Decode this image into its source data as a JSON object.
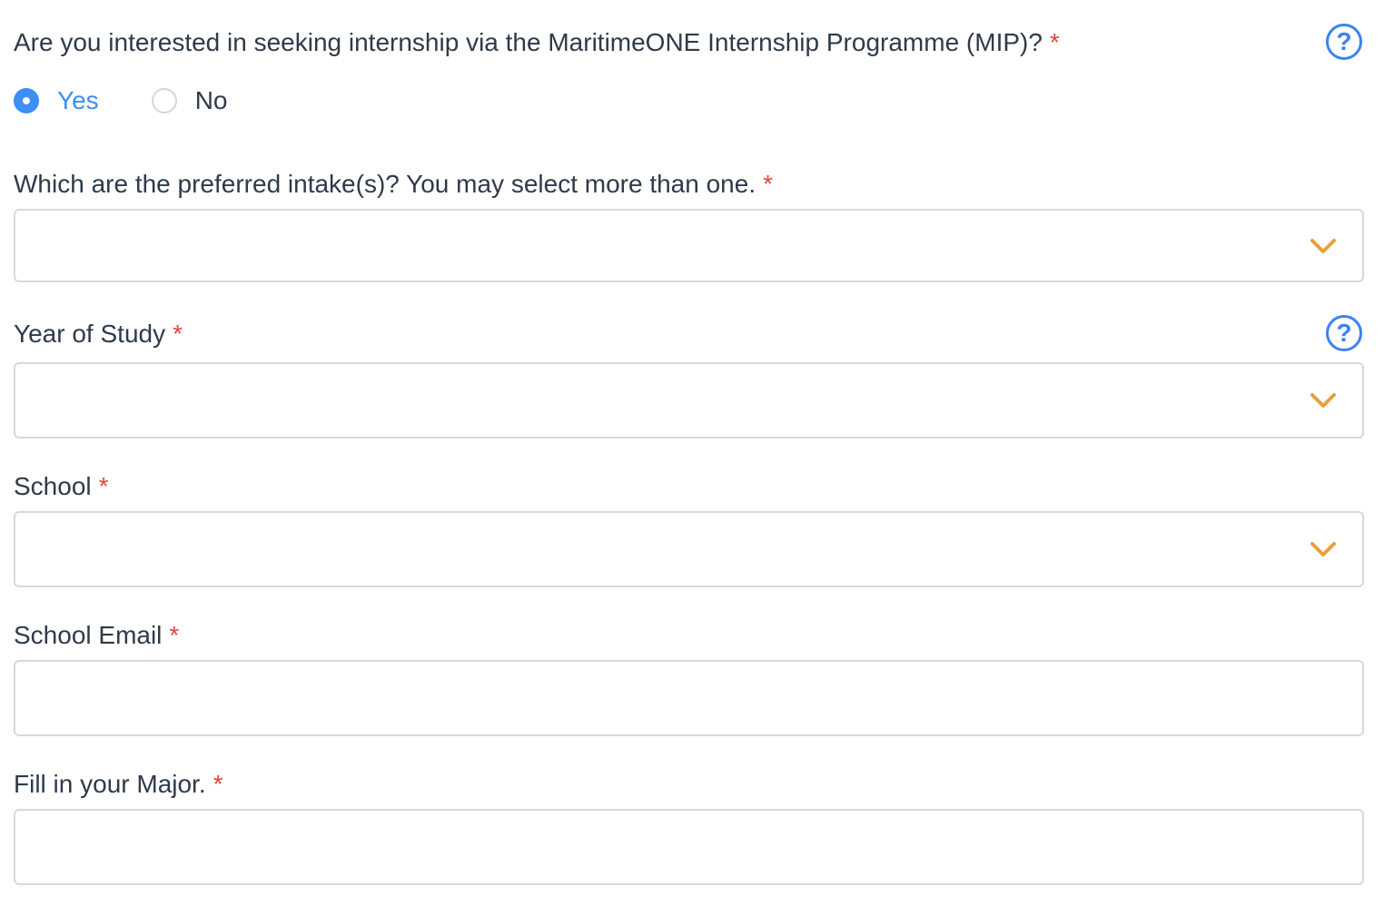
{
  "mip_question": {
    "label": "Are you interested in seeking internship via the MaritimeONE Internship Programme (MIP)?",
    "required_mark": "*",
    "help_icon": "question-circle-icon",
    "options": [
      {
        "label": "Yes",
        "selected": true
      },
      {
        "label": "No",
        "selected": false
      }
    ]
  },
  "intake": {
    "label": "Which are the preferred intake(s)? You may select more than one.",
    "required_mark": "*",
    "value": "",
    "icon": "chevron-down-icon"
  },
  "year_of_study": {
    "label": "Year of Study",
    "required_mark": "*",
    "help_icon": "question-circle-icon",
    "value": "",
    "icon": "chevron-down-icon"
  },
  "school": {
    "label": "School",
    "required_mark": "*",
    "value": "",
    "icon": "chevron-down-icon"
  },
  "school_email": {
    "label": "School Email",
    "required_mark": "*",
    "value": ""
  },
  "major": {
    "label": "Fill in your Major.",
    "required_mark": "*",
    "value": ""
  },
  "colors": {
    "accent_blue": "#3b82f6",
    "radio_blue": "#3b8ff6",
    "required_red": "#e0443e",
    "chevron_orange": "#e8a03c",
    "border_gray": "#d6d9dd",
    "text": "#2f3a4a"
  },
  "help_glyph": "?"
}
